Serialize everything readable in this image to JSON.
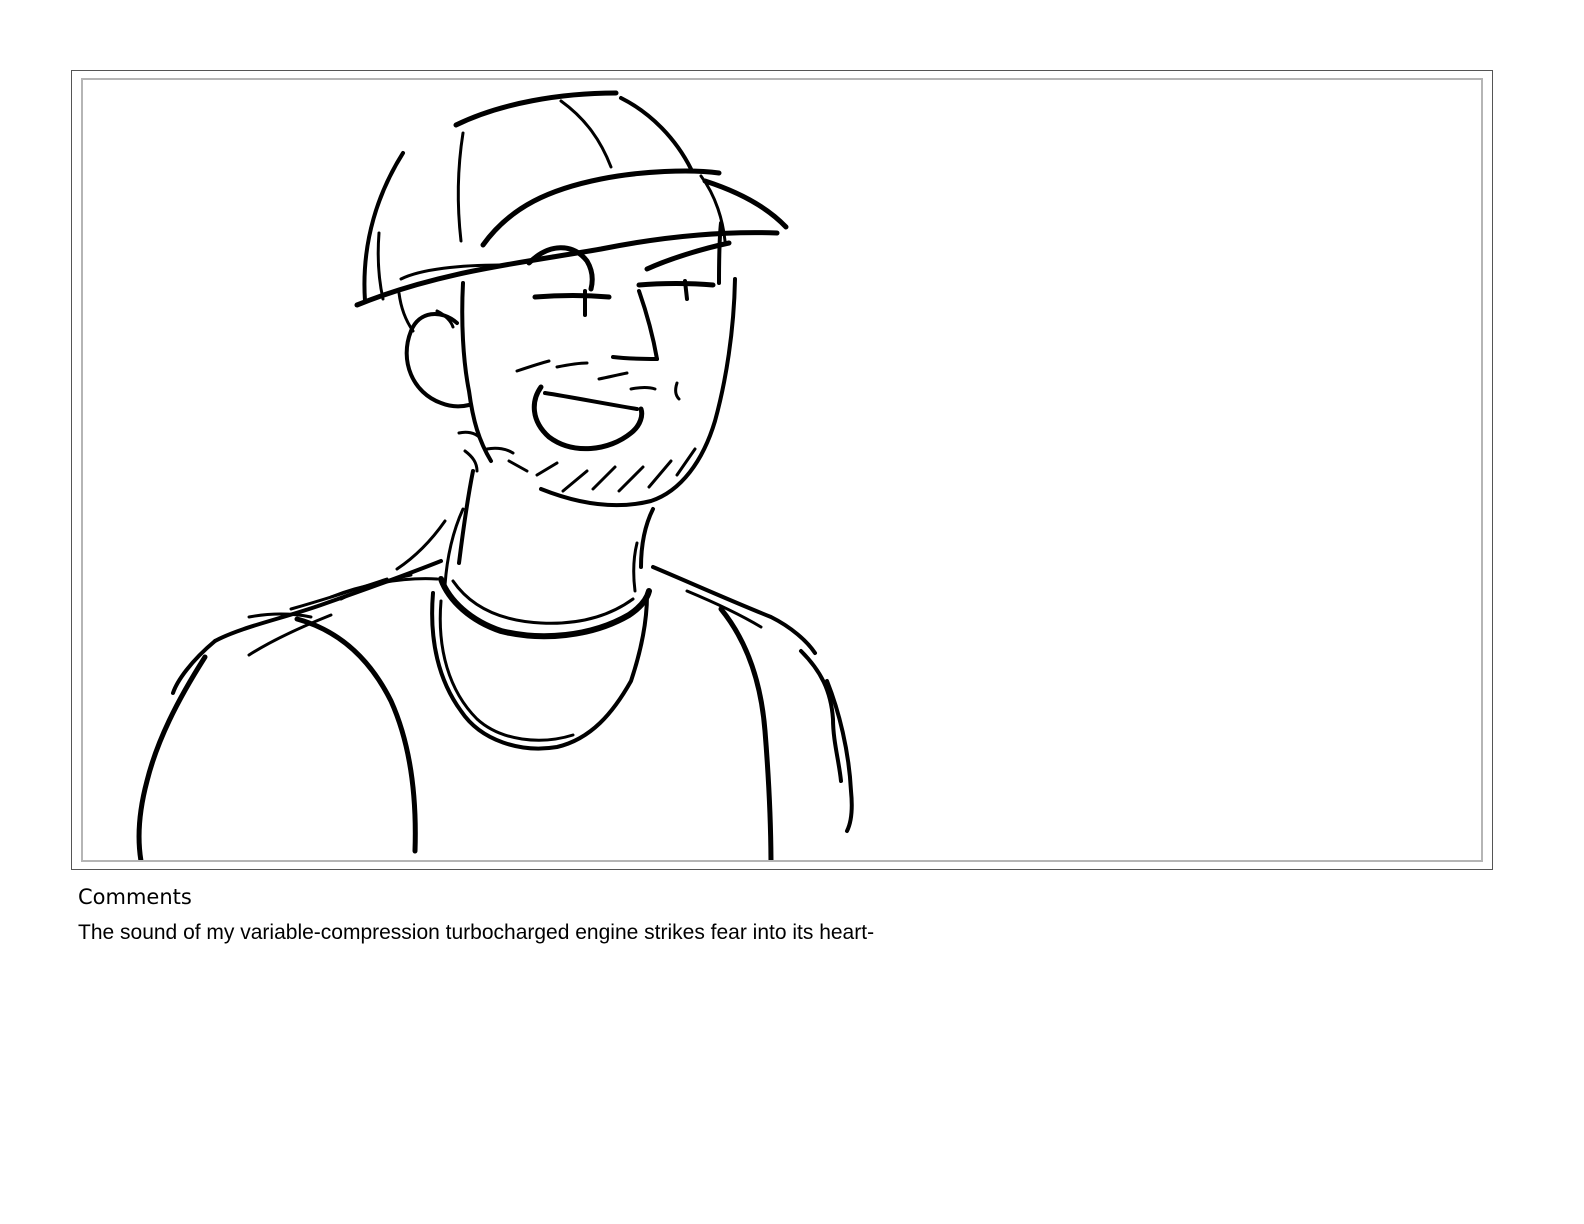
{
  "comments": {
    "heading": "Comments",
    "text": "The sound of my variable-compression turbocharged engine strikes fear into its heart-"
  },
  "panel": {
    "sketch_icon": "man-in-cap-sketch-icon"
  }
}
